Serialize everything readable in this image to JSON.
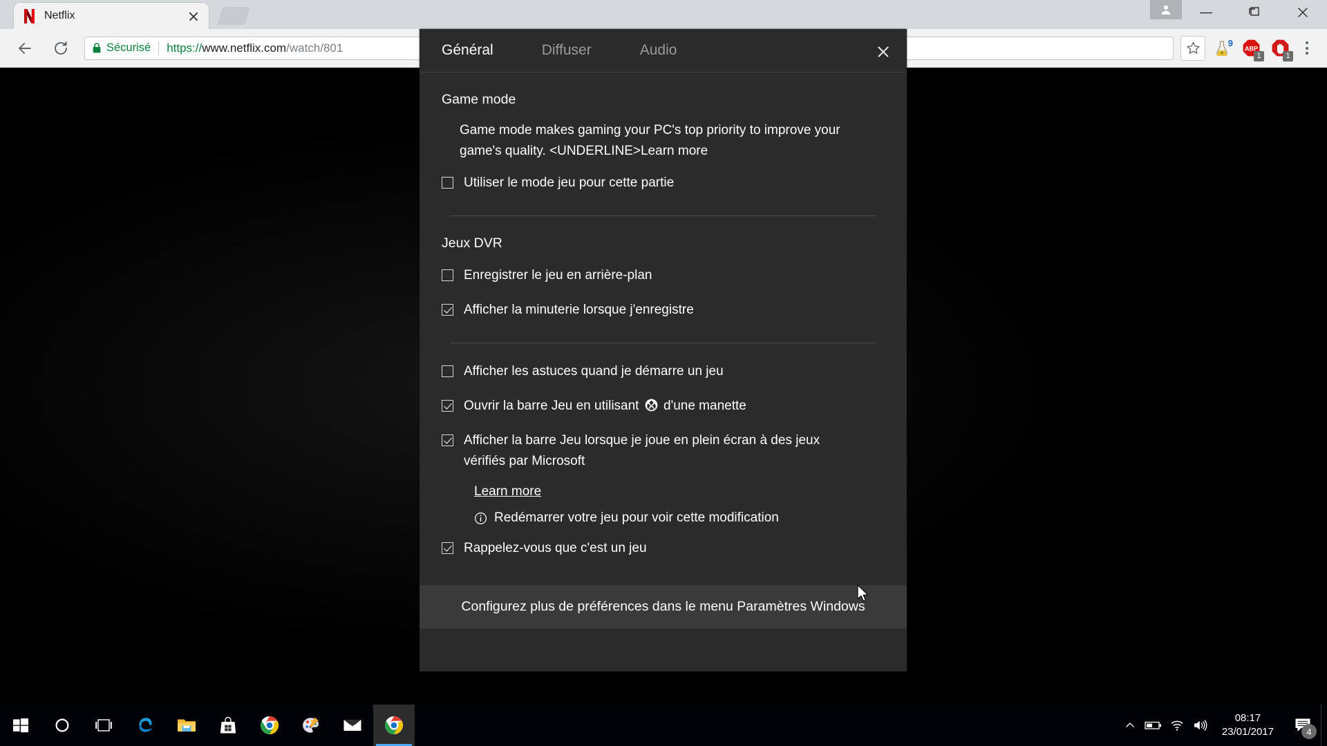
{
  "browser": {
    "tab": {
      "title": "Netflix",
      "favicon": "netflix-icon",
      "close": "×"
    },
    "newtab_label": "+",
    "window_controls": {
      "account": "account-icon",
      "minimize": "—",
      "maximize": "□",
      "close": "×"
    },
    "nav": {
      "back": "back-arrow-icon",
      "forward": "forward-arrow-icon",
      "reload": "reload-icon"
    },
    "omnibox": {
      "secure_label": "Sécurisé",
      "url_scheme": "https://",
      "url_host": "www.netflix.com",
      "url_path": "/watch/801",
      "lock": "lock-icon"
    },
    "toolbar_icons": [
      {
        "name": "bookmark-star-icon",
        "badge": ""
      },
      {
        "name": "flask-experiment-icon",
        "badge": "9"
      },
      {
        "name": "adblock-plus-icon",
        "label": "ABP",
        "badge": "1"
      },
      {
        "name": "blocker-hand-icon",
        "badge": "1"
      },
      {
        "name": "chrome-menu-icon",
        "badge": ""
      }
    ]
  },
  "flyout": {
    "tabs": [
      {
        "label": "Général",
        "active": true
      },
      {
        "label": "Diffuser",
        "active": false
      },
      {
        "label": "Audio",
        "active": false
      }
    ],
    "close_label": "×",
    "sections": {
      "game_mode": {
        "title": "Game mode",
        "description": "Game mode makes gaming your PC's top priority to improve your game's quality. <UNDERLINE>Learn more",
        "checkbox": {
          "label": "Utiliser le mode jeu pour cette partie",
          "checked": false
        }
      },
      "dvr": {
        "title": "Jeux DVR",
        "checkboxes": [
          {
            "label": "Enregistrer le jeu en arrière-plan",
            "checked": false
          },
          {
            "label": "Afficher la minuterie lorsque j'enregistre",
            "checked": true
          }
        ]
      },
      "misc": {
        "checkboxes": [
          {
            "label": "Afficher les astuces quand je démarre un jeu",
            "checked": false
          },
          {
            "label_before": "Ouvrir la barre Jeu en utilisant ",
            "glyph": "xbox-icon",
            "label_after": " d'une manette",
            "checked": true
          },
          {
            "label": "Afficher la barre Jeu lorsque je joue en plein écran à des jeux vérifiés par Microsoft",
            "checked": true
          }
        ],
        "learn_more": "Learn more",
        "info_note": "Redémarrer votre jeu pour voir cette modification",
        "info_icon": "info-circle-icon",
        "last_checkbox": {
          "label": "Rappelez-vous que c'est un jeu",
          "checked": true
        }
      }
    },
    "footer": "Configurez plus de préférences dans le menu Paramètres Windows"
  },
  "taskbar": {
    "items": [
      {
        "name": "start-button",
        "icon": "windows-logo-icon"
      },
      {
        "name": "cortana-button",
        "icon": "cortana-circle-icon"
      },
      {
        "name": "task-view-button",
        "icon": "task-view-icon"
      },
      {
        "name": "edge-button",
        "icon": "edge-icon"
      },
      {
        "name": "file-explorer-button",
        "icon": "folder-icon"
      },
      {
        "name": "store-button",
        "icon": "shopping-bag-icon"
      },
      {
        "name": "chrome-button",
        "icon": "chrome-icon"
      },
      {
        "name": "paint3d-button",
        "icon": "paint-palette-icon"
      },
      {
        "name": "mail-button",
        "icon": "envelope-icon"
      },
      {
        "name": "chrome-active-button",
        "icon": "chrome-icon",
        "active": true
      }
    ],
    "tray": {
      "chevron": "chevron-up-icon",
      "battery": "battery-icon",
      "wifi": "wifi-icon",
      "volume": "volume-icon",
      "time": "08:17",
      "date": "23/01/2017",
      "notifications_icon": "action-center-icon",
      "notifications_count": "4"
    }
  }
}
